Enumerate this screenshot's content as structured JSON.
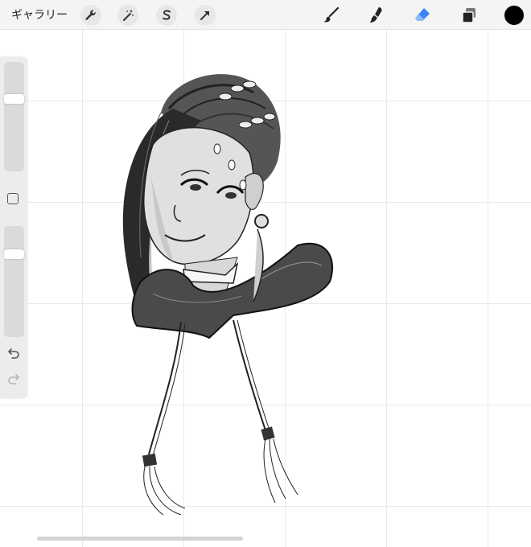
{
  "toolbar": {
    "gallery_label": "ギャラリー",
    "left_tools": [
      {
        "name": "actions",
        "icon": "wrench-icon"
      },
      {
        "name": "adjustments",
        "icon": "magic-wand-icon"
      },
      {
        "name": "selection",
        "icon": "selection-s-icon"
      },
      {
        "name": "transform",
        "icon": "arrow-cursor-icon"
      }
    ],
    "right_tools": [
      {
        "name": "brush",
        "icon": "brush-icon"
      },
      {
        "name": "smudge",
        "icon": "smudge-icon"
      },
      {
        "name": "eraser",
        "icon": "eraser-icon",
        "active": true
      },
      {
        "name": "layers",
        "icon": "layers-icon"
      },
      {
        "name": "color",
        "icon": "color-swatch-icon",
        "value": "#000000"
      }
    ]
  },
  "sidebar": {
    "brush_size_level": 0.38,
    "opacity_level": 0.27,
    "modify_icon": "square-modify-icon",
    "undo_icon": "undo-icon",
    "redo_icon": "redo-icon"
  },
  "colors": {
    "active_tool": "#3b82f6",
    "toolbar_bg": "#f4f4f4",
    "current_color": "#000000"
  }
}
